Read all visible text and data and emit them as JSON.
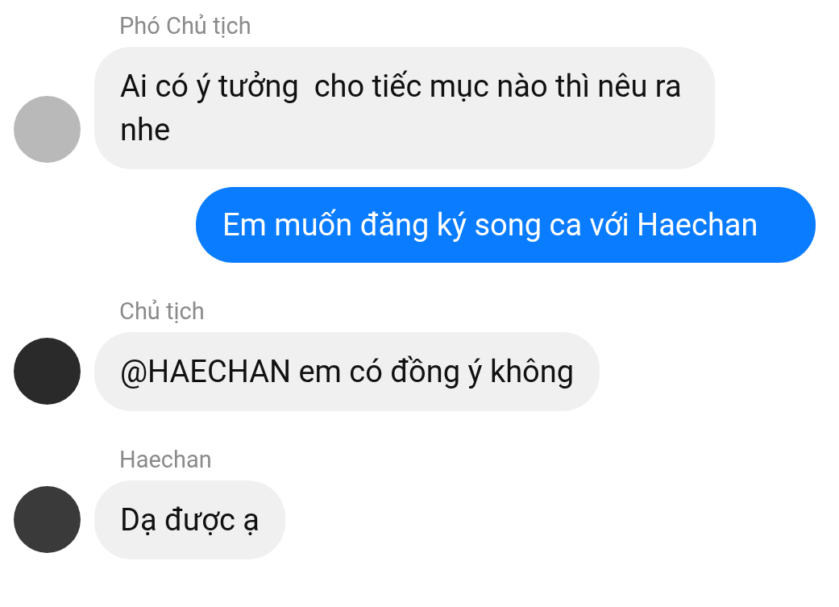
{
  "messages": [
    {
      "kind": "incoming",
      "sender": "Phó Chủ tịch",
      "text": "Ai có ý tưởng  cho tiếc mục nào thì nêu ra nhe"
    },
    {
      "kind": "outgoing",
      "text": "Em muốn đăng ký song ca với Haechan"
    },
    {
      "kind": "incoming",
      "sender": "Chủ tịch",
      "text": "@HAECHAN em có đồng ý không"
    },
    {
      "kind": "incoming",
      "sender": "Haechan",
      "text": "Dạ được ạ"
    }
  ]
}
